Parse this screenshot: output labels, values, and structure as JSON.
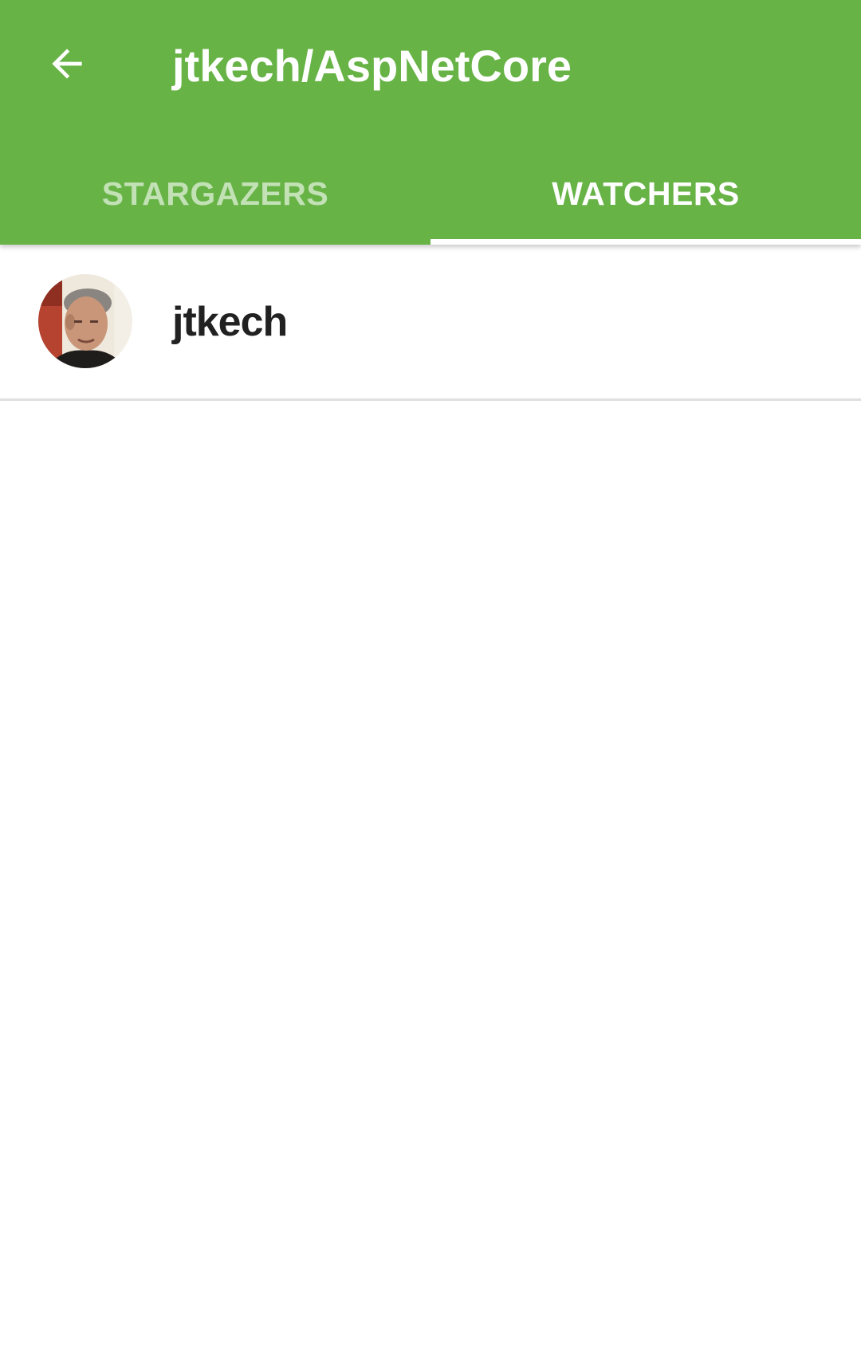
{
  "app_bar": {
    "title": "jtkech/AspNetCore",
    "back_icon": "arrow-back-icon",
    "background_color": "#67b346"
  },
  "tabs": [
    {
      "label": "STARGAZERS",
      "selected": false
    },
    {
      "label": "WATCHERS",
      "selected": true
    }
  ],
  "watchers": [
    {
      "username": "jtkech",
      "avatar": "user-avatar"
    }
  ]
}
